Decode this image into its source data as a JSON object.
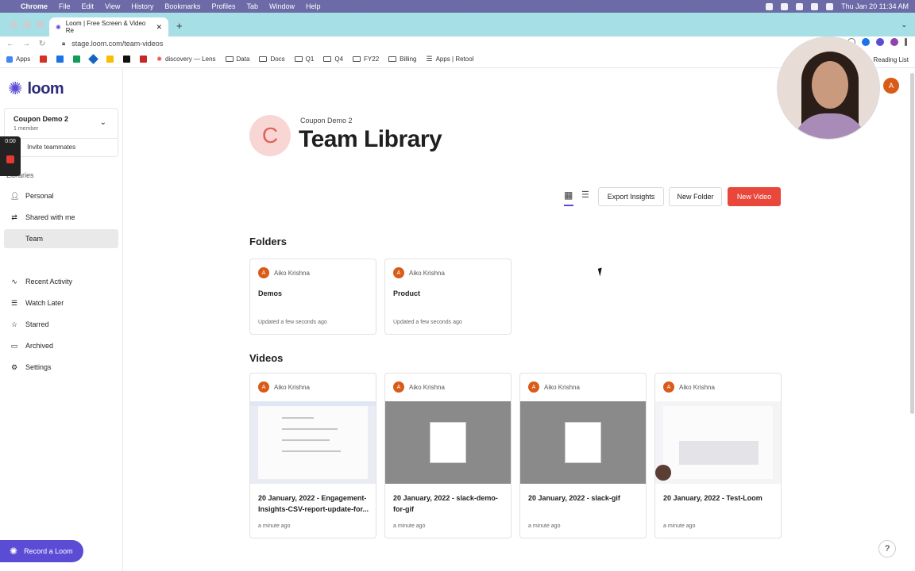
{
  "menubar": {
    "app": "Chrome",
    "items": [
      "File",
      "Edit",
      "View",
      "History",
      "Bookmarks",
      "Profiles",
      "Tab",
      "Window",
      "Help"
    ],
    "clock": "Thu Jan 20  11:34 AM"
  },
  "browser": {
    "tab_title": "Loom | Free Screen & Video Re",
    "url": "stage.loom.com/team-videos",
    "bookmarks": [
      "Apps",
      "discovery — Lens",
      "Data",
      "Docs",
      "Q1",
      "Q4",
      "FY22",
      "Billing",
      "Apps | Retool"
    ],
    "reading_list": "Reading List"
  },
  "sidebar": {
    "logo": "loom",
    "workspace": {
      "name": "Coupon Demo 2",
      "members": "1 member",
      "invite": "Invite teammates"
    },
    "libraries_label": "Libraries",
    "libraries": [
      "Personal",
      "Shared with me",
      "Team"
    ],
    "nav": [
      "Recent Activity",
      "Watch Later",
      "Starred",
      "Archived",
      "Settings"
    ],
    "record": "Record a Loom",
    "timer": "0:00"
  },
  "header": {
    "avatar_letter": "C",
    "workspace": "Coupon Demo 2",
    "title": "Team Library",
    "user_initial": "A"
  },
  "toolbar": {
    "export": "Export Insights",
    "new_folder": "New Folder",
    "new_video": "New Video"
  },
  "folders_heading": "Folders",
  "folders": [
    {
      "owner": "Aiko Krishna",
      "initial": "A",
      "name": "Demos",
      "updated": "Updated a few seconds ago"
    },
    {
      "owner": "Aiko Krishna",
      "initial": "A",
      "name": "Product",
      "updated": "Updated a few seconds ago"
    }
  ],
  "videos_heading": "Videos",
  "videos": [
    {
      "owner": "Aiko Krishna",
      "initial": "A",
      "title": "20 January, 2022 - Engagement-Insights-CSV-report-update-for...",
      "time": "a minute ago"
    },
    {
      "owner": "Aiko Krishna",
      "initial": "A",
      "title": "20 January, 2022 - slack-demo-for-gif",
      "time": "a minute ago"
    },
    {
      "owner": "Aiko Krishna",
      "initial": "A",
      "title": "20 January, 2022 - slack-gif",
      "time": "a minute ago"
    },
    {
      "owner": "Aiko Krishna",
      "initial": "A",
      "title": "20 January, 2022 - Test-Loom",
      "time": "a minute ago"
    }
  ],
  "colors": {
    "brand": "#5b4cd6",
    "accent": "#e8473a",
    "avatar": "#d95b18"
  }
}
